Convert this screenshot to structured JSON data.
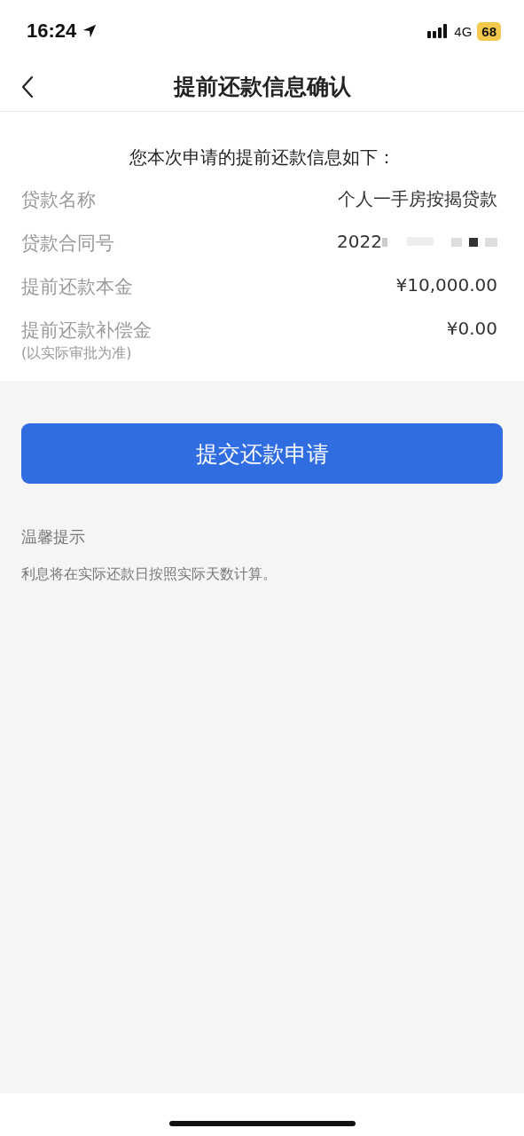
{
  "status_bar": {
    "time": "16:24",
    "network": "4G",
    "battery": "68",
    "low_power": true
  },
  "nav": {
    "title": "提前还款信息确认"
  },
  "intro": "您本次申请的提前还款信息如下：",
  "rows": [
    {
      "label": "贷款名称",
      "value": "个人一手房按揭贷款"
    },
    {
      "label": "贷款合同号",
      "value": "2022",
      "redacted": true
    },
    {
      "label": "提前还款本金",
      "value": "¥10,000.00"
    },
    {
      "label": "提前还款补偿金",
      "value": "¥0.00",
      "note": "(以实际审批为准)"
    }
  ],
  "submit_button": "提交还款申请",
  "tips": {
    "title": "温馨提示",
    "text": "利息将在实际还款日按照实际天数计算。"
  }
}
